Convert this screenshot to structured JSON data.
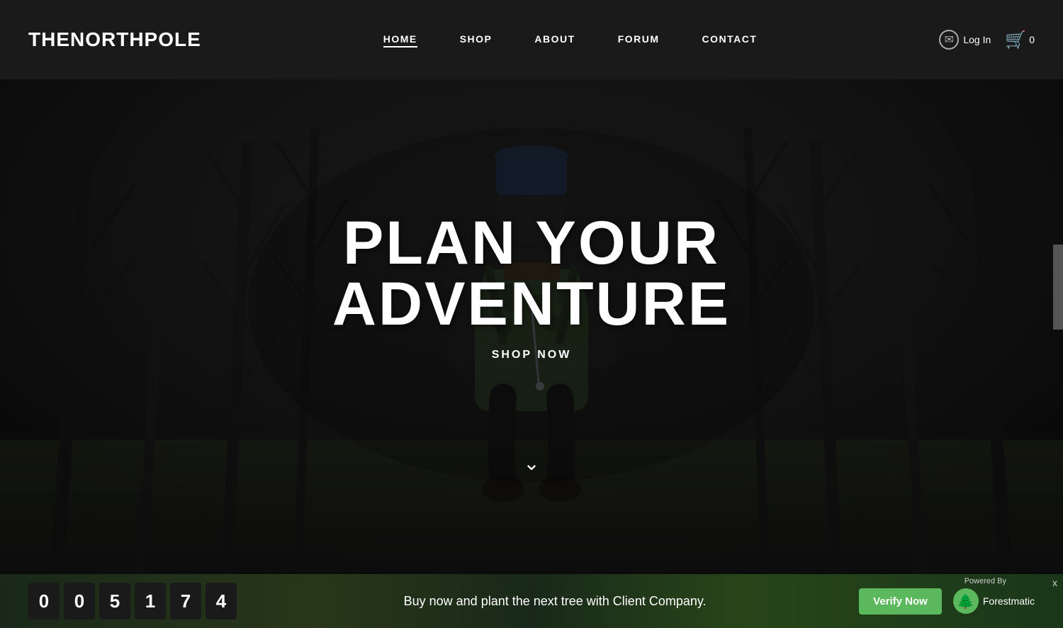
{
  "brand": {
    "name_prefix": "THE",
    "name_suffix": "NORTHPOLE"
  },
  "navbar": {
    "links": [
      {
        "label": "HOME",
        "active": true
      },
      {
        "label": "SHOP",
        "active": false
      },
      {
        "label": "ABOUT",
        "active": false
      },
      {
        "label": "FORUM",
        "active": false
      },
      {
        "label": "CONTACT",
        "active": false
      }
    ],
    "login_label": "Log In",
    "cart_count": "0"
  },
  "hero": {
    "title": "PLAN YOUR ADVENTURE",
    "cta_label": "SHOP NOW",
    "scroll_hint": "⌄"
  },
  "banner": {
    "digits": [
      "0",
      "0",
      "5",
      "1",
      "7",
      "4"
    ],
    "text": "Buy now and plant the next tree with Client Company.",
    "verify_label": "Verify Now",
    "powered_by": "Powered By",
    "brand_name": "Forestmatic",
    "close_label": "x"
  }
}
